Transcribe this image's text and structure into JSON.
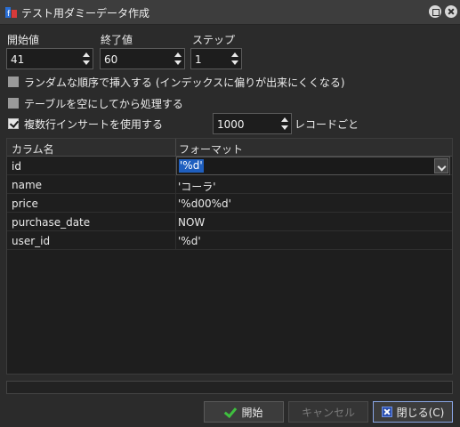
{
  "window": {
    "title": "テスト用ダミーデータ作成",
    "app_icon": "app-logo-icon",
    "minimize_icon": "restore-icon",
    "close_icon": "close-icon"
  },
  "params": {
    "start_label": "開始値",
    "start_value": "41",
    "end_label": "終了値",
    "end_value": "60",
    "step_label": "ステップ",
    "step_value": "1"
  },
  "options": {
    "random_order_label": "ランダムな順序で挿入する (インデックスに偏りが出来にくくなる)",
    "random_order_checked": false,
    "truncate_label": "テーブルを空にしてから処理する",
    "truncate_checked": false,
    "multi_insert_label": "複数行インサートを使用する",
    "multi_insert_checked": true,
    "per_records_value": "1000",
    "per_records_label": "レコードごと"
  },
  "grid": {
    "col_name": "カラム名",
    "col_format": "フォーマット",
    "rows": [
      {
        "name": "id",
        "format": "'%d'"
      },
      {
        "name": "name",
        "format": "'コーラ'"
      },
      {
        "name": "price",
        "format": "'%d00%d'"
      },
      {
        "name": "purchase_date",
        "format": "NOW"
      },
      {
        "name": "user_id",
        "format": "'%d'"
      }
    ]
  },
  "progress": {
    "fraction": 0
  },
  "buttons": {
    "start_label": "開始",
    "cancel_label": "キャンセル",
    "close_label": "閉じる(C)"
  },
  "colors": {
    "selection": "#1f5fbf",
    "start_icon": "#3fbf3f",
    "close_icon": "#2a4fb0"
  }
}
